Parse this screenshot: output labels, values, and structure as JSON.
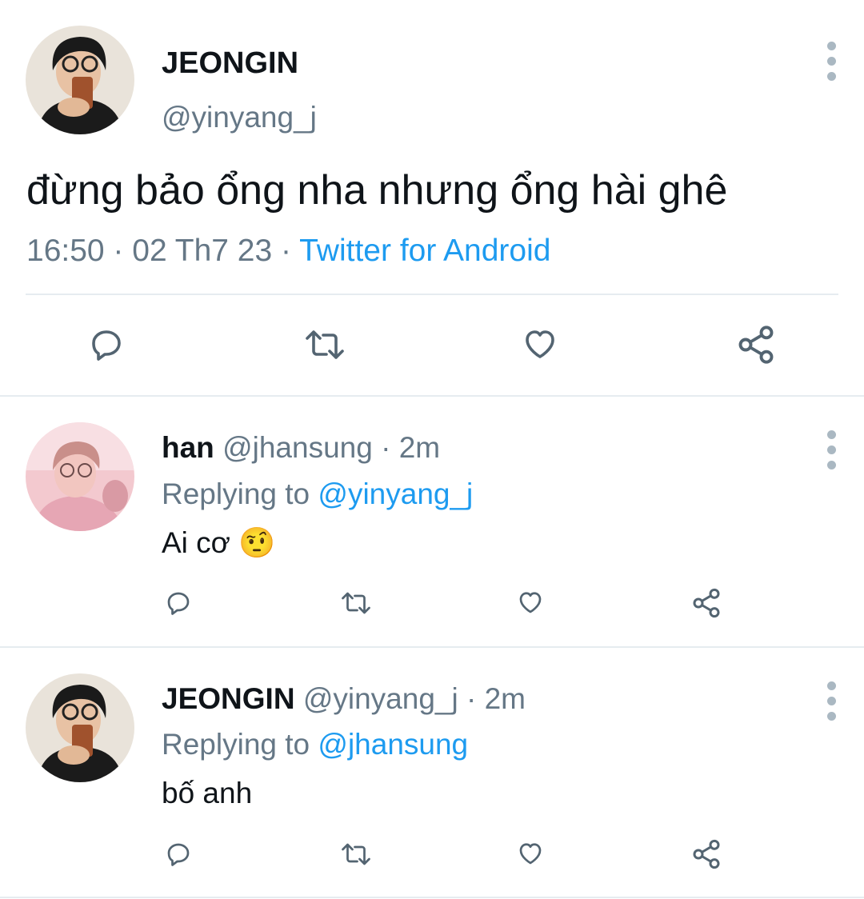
{
  "main_tweet": {
    "display_name": "JEONGIN",
    "handle": "@yinyang_j",
    "text": "đừng bảo ổng nha nhưng ổng hài ghê",
    "time_date": "16:50 · 02 Th7 23 · ",
    "source": "Twitter for Android",
    "actions": [
      "reply-icon",
      "retweet-icon",
      "like-icon",
      "share-icon"
    ]
  },
  "replies": [
    {
      "display_name": "han",
      "handle_time": "@jhansung · 2m",
      "replying_prefix": "Replying to ",
      "replying_to": "@yinyang_j",
      "text": "Ai cơ",
      "emoji": "🤨"
    },
    {
      "display_name": "JEONGIN",
      "handle_time": "@yinyang_j · 2m",
      "replying_prefix": "Replying to ",
      "replying_to": "@jhansung",
      "text": "bố anh"
    }
  ],
  "colors": {
    "link": "#1d9bf0",
    "secondary_text": "#657786",
    "icon": "#536471",
    "divider": "#e6ecf0"
  }
}
